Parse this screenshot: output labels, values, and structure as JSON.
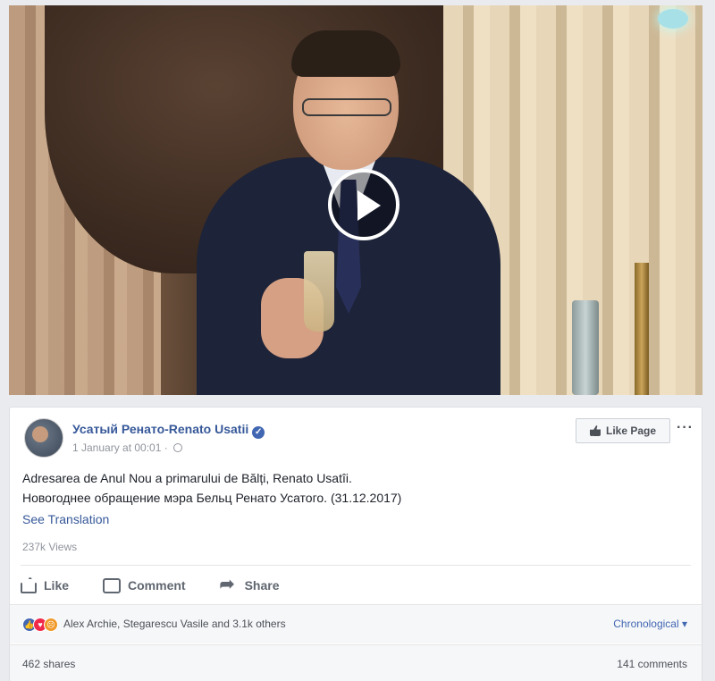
{
  "post": {
    "page_name": "Усатый Ренато-Renato Usatii",
    "date": "1 January at 00:01",
    "separator": "·",
    "text_line1": "Adresarea de Anul Nou a primarului de Bălți, Renato Usatîi.",
    "text_line2": "Новогоднее обращение мэра Бельц Ренато Усатого. (31.12.2017)",
    "see_translation": "See Translation",
    "views": "237k Views",
    "like_page_label": "Like Page",
    "more_label": "···"
  },
  "actions": {
    "like": "Like",
    "comment": "Comment",
    "share": "Share"
  },
  "reactions": {
    "names": "Alex Archie, Stegarescu Vasile and 3.1k others",
    "sort": "Chronological ▾",
    "icons": [
      "like-reaction",
      "love-reaction",
      "angry-reaction"
    ]
  },
  "stats": {
    "shares": "462 shares",
    "comments": "141 comments"
  },
  "colors": {
    "link": "#365899",
    "accent": "#4267b2",
    "muted": "#90949c"
  }
}
